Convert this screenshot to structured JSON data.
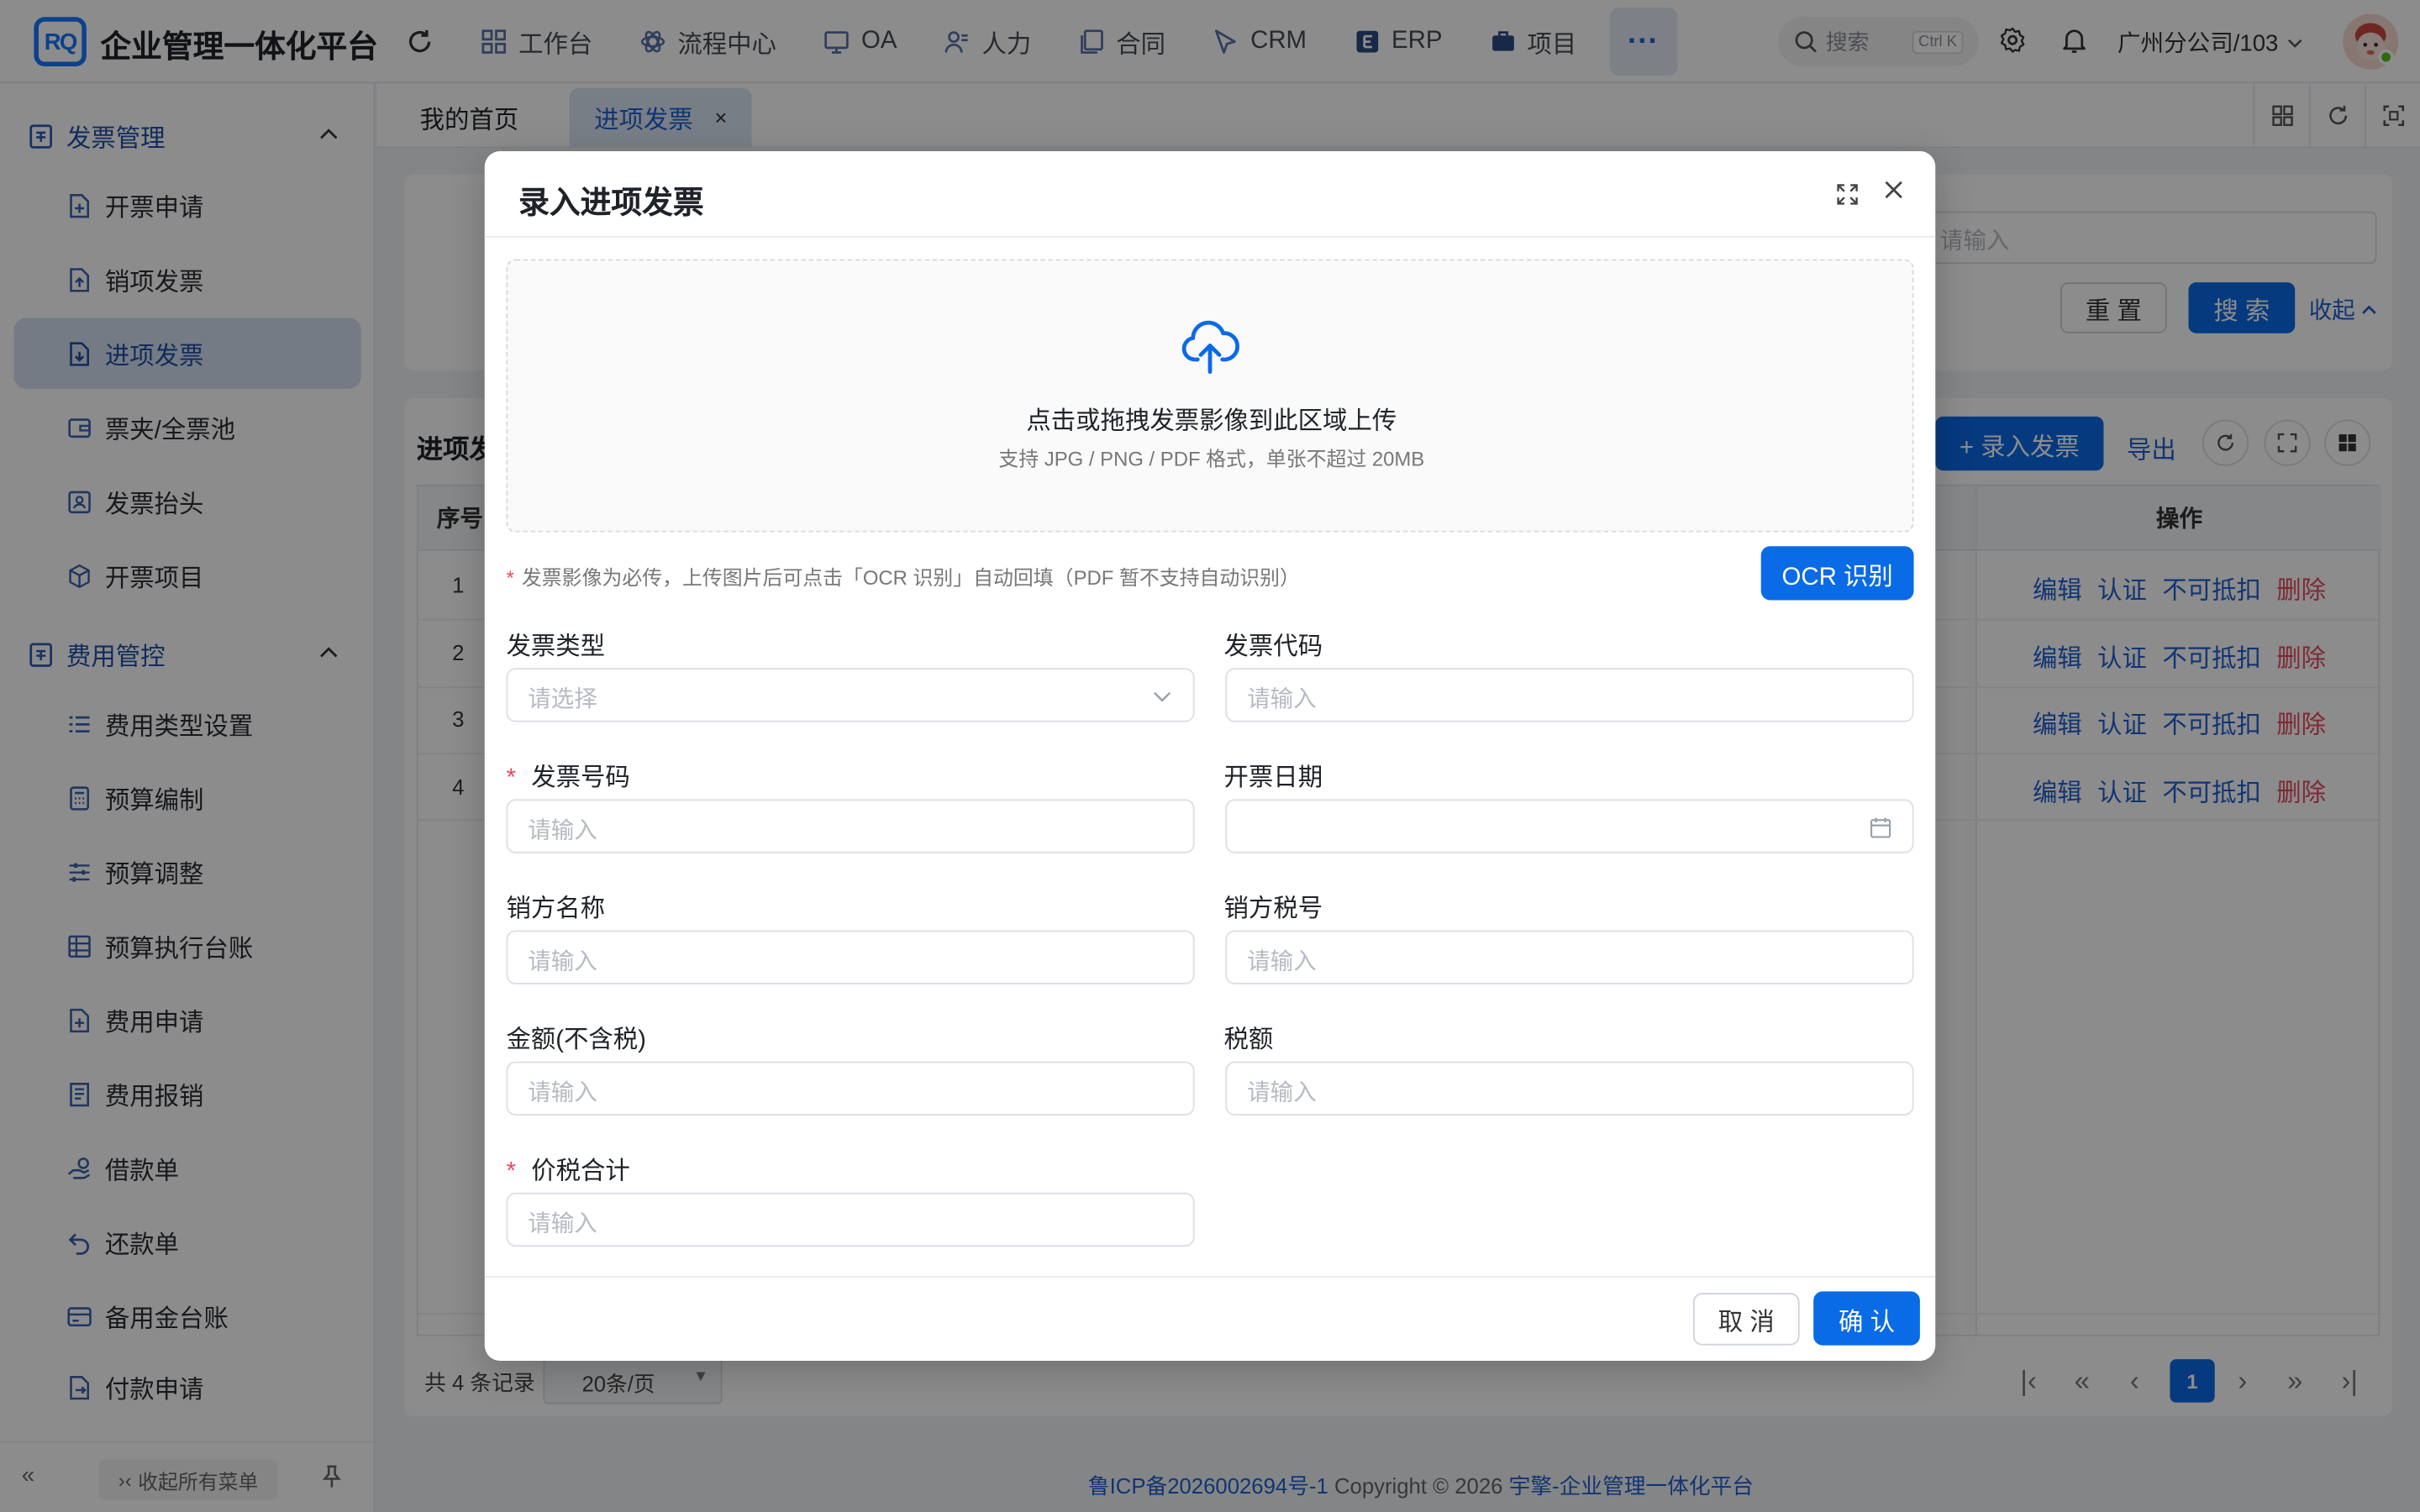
{
  "app": {
    "logo_text": "RQ",
    "title": "企业管理一体化平台"
  },
  "nav": {
    "items": [
      "工作台",
      "流程中心",
      "OA",
      "人力",
      "合同",
      "CRM",
      "ERP",
      "项目"
    ],
    "more": "···"
  },
  "search": {
    "placeholder": "搜索",
    "shortcut": "Ctrl K"
  },
  "org": {
    "label": "广州分公司/103"
  },
  "sidebar": {
    "group1": "发票管理",
    "group1_items": [
      "开票申请",
      "销项发票",
      "进项发票",
      "票夹/全票池",
      "发票抬头",
      "开票项目"
    ],
    "group2": "费用管控",
    "group2_items": [
      "费用类型设置",
      "预算编制",
      "预算调整",
      "预算执行台账",
      "费用申请",
      "费用报销",
      "借款单",
      "还款单",
      "备用金台账",
      "付款申请"
    ],
    "collapse_all": "收起所有菜单",
    "active_item": "进项发票"
  },
  "tabs": {
    "home": "我的首页",
    "current": "进项发票",
    "close": "×"
  },
  "filter": {
    "input_placeholder": "请输入",
    "reset": "重 置",
    "search": "搜 索",
    "collapse": "收起"
  },
  "table": {
    "title": "进项发",
    "add_button": "+ 录入发票",
    "export": "导出",
    "col_index": "序号",
    "col_ops": "操作",
    "rows": [
      {
        "index": "1",
        "ops": [
          "编辑",
          "认证",
          "不可抵扣",
          "删除"
        ]
      },
      {
        "index": "2",
        "ops": [
          "编辑",
          "认证",
          "不可抵扣",
          "删除"
        ]
      },
      {
        "index": "3",
        "ops": [
          "编辑",
          "认证",
          "不可抵扣",
          "删除"
        ]
      },
      {
        "index": "4",
        "ops": [
          "编辑",
          "认证",
          "不可抵扣",
          "删除"
        ]
      }
    ],
    "total": "共 4 条记录",
    "page_size": "20条/页",
    "current_page": "1"
  },
  "footer": {
    "icp": "鲁ICP备2026002694号-1",
    "copyright": " Copyright © 2026 ",
    "brand": "宇擎-企业管理一体化平台"
  },
  "modal": {
    "title": "录入进项发票",
    "upload_main": "点击或拖拽发票影像到此区域上传",
    "upload_sub": "支持 JPG / PNG / PDF 格式，单张不超过 20MB",
    "hint": "发票影像为必传，上传图片后可点击「OCR 识别」自动回填（PDF 暂不支持自动识别）",
    "ocr_button": "OCR 识别",
    "fields": {
      "invoice_type": {
        "label": "发票类型",
        "placeholder": "请选择"
      },
      "invoice_code": {
        "label": "发票代码",
        "placeholder": "请输入"
      },
      "invoice_number": {
        "label": "发票号码",
        "placeholder": "请输入",
        "required": true
      },
      "invoice_date": {
        "label": "开票日期",
        "placeholder": ""
      },
      "seller_name": {
        "label": "销方名称",
        "placeholder": "请输入"
      },
      "seller_tax_no": {
        "label": "销方税号",
        "placeholder": "请输入"
      },
      "amount": {
        "label": "金额(不含税)",
        "placeholder": "请输入"
      },
      "tax": {
        "label": "税额",
        "placeholder": "请输入"
      },
      "total": {
        "label": "价税合计",
        "placeholder": "请输入",
        "required": true
      }
    },
    "cancel": "取 消",
    "confirm": "确 认"
  },
  "colors": {
    "primary": "#0a6be6",
    "danger": "#e84a5f",
    "link": "#1f5fd1"
  }
}
